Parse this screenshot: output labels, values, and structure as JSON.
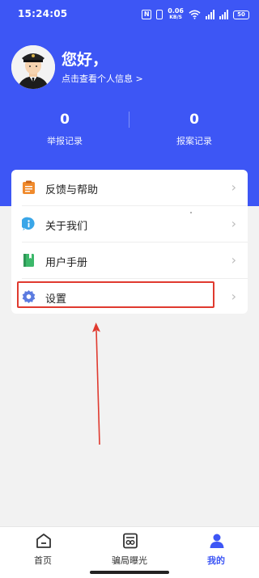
{
  "status_bar": {
    "time": "15:24:05",
    "nfc": "N",
    "speed_value": "0.06",
    "speed_unit": "KB/S",
    "battery": "50"
  },
  "profile": {
    "greeting": "您好，",
    "link": "点击查看个人信息 >"
  },
  "stats": [
    {
      "value": "0",
      "label": "举报记录"
    },
    {
      "value": "0",
      "label": "报案记录"
    }
  ],
  "menu": {
    "items": [
      {
        "label": "反馈与帮助",
        "icon": "clipboard-icon",
        "color": "#f08a2c"
      },
      {
        "label": "关于我们",
        "icon": "info-icon",
        "color": "#3aa6e8"
      },
      {
        "label": "用户手册",
        "icon": "book-icon",
        "color": "#3cb86a"
      },
      {
        "label": "设置",
        "icon": "gear-icon",
        "color": "#5b7be0"
      }
    ],
    "chevron": "›"
  },
  "annotation": {
    "highlight_color": "#e03a2f"
  },
  "bottom_nav": {
    "items": [
      {
        "label": "首页",
        "icon": "home-icon"
      },
      {
        "label": "骗局曝光",
        "icon": "exposure-icon"
      },
      {
        "label": "我的",
        "icon": "user-icon"
      }
    ],
    "active_index": 2
  },
  "colors": {
    "primary": "#3d56f5",
    "background": "#f2f2f2"
  }
}
